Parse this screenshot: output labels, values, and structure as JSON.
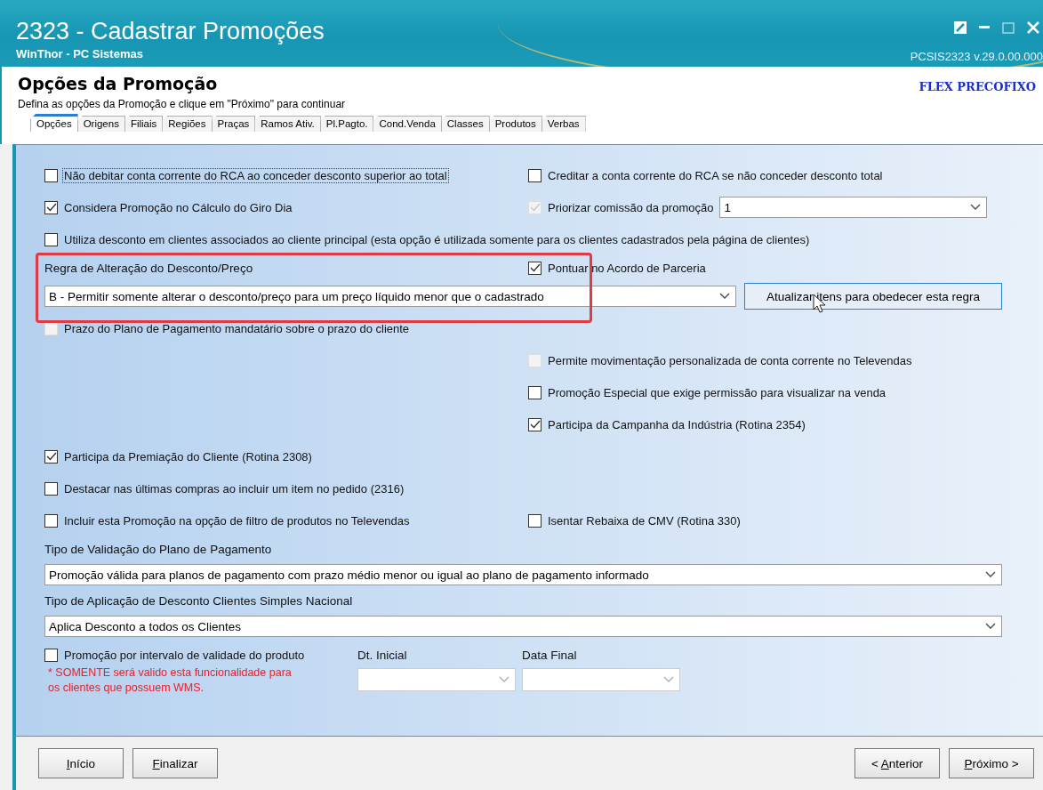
{
  "window": {
    "title": "2323 - Cadastrar Promoções",
    "subtitle": "WinThor - PC Sistemas",
    "version": "PCSIS2323  v.29.0.00.000"
  },
  "header": {
    "title": "Opções da Promoção",
    "hint": "Defina as opções da Promoção e clique em \"Próximo\" para continuar",
    "badge": "FLEX PRECOFIXO"
  },
  "tabs": [
    {
      "label": "Opções",
      "selected": true
    },
    {
      "label": "Origens",
      "selected": false
    },
    {
      "label": "Filiais",
      "selected": false
    },
    {
      "label": "Regiões",
      "selected": false
    },
    {
      "label": "Praças",
      "selected": false
    },
    {
      "label": "Ramos Ativ.",
      "selected": false
    },
    {
      "label": "Pl.Pagto.",
      "selected": false
    },
    {
      "label": "Cond.Venda",
      "selected": false
    },
    {
      "label": "Classes",
      "selected": false
    },
    {
      "label": "Produtos",
      "selected": false
    },
    {
      "label": "Verbas",
      "selected": false
    }
  ],
  "rows": [
    {
      "left": {
        "kind": "checkbox",
        "label": "Não debitar conta corrente do RCA ao conceder desconto superior ao total",
        "checked": false,
        "disabled": false,
        "focused": true
      },
      "right": {
        "kind": "checkbox",
        "label": "Creditar a conta corrente do RCA se não conceder desconto total",
        "checked": false,
        "disabled": false,
        "focused": false
      }
    },
    {
      "left": {
        "kind": "checkbox",
        "label": "Considera Promoção no Cálculo do Giro Dia",
        "checked": true,
        "disabled": false,
        "focused": false
      },
      "right": {
        "kind": "checkbox_combo",
        "label": "Priorizar comissão da promoção",
        "checked": true,
        "disabled": true,
        "focused": false,
        "value": "1"
      }
    },
    {
      "full": {
        "kind": "checkbox",
        "label": "Utiliza desconto em clientes associados ao cliente principal (esta opção é utilizada somente para os clientes cadastrados pela  página de clientes)",
        "checked": false,
        "disabled": false,
        "focused": false
      }
    },
    {
      "left": {
        "kind": "label",
        "text": "Regra de Alteração do Desconto/Preço"
      },
      "right": {
        "kind": "checkbox",
        "label": "Pontuar no Acordo de Parceria",
        "checked": true,
        "disabled": false,
        "focused": false
      }
    },
    {
      "full": {
        "kind": "combo_button",
        "value": "B - Permitir somente alterar o desconto/preço para um preço líquido menor que o cadastrado",
        "button": "Atualizar itens para obedecer esta regra"
      }
    },
    {
      "left": {
        "kind": "checkbox",
        "label": "Prazo do Plano de Pagamento mandatário sobre o prazo do cliente",
        "checked": false,
        "disabled": true,
        "focused": false
      }
    },
    {
      "right": {
        "kind": "checkbox",
        "label": "Permite movimentação personalizada de conta corrente no Televendas",
        "checked": false,
        "disabled": true,
        "focused": false
      }
    },
    {
      "right": {
        "kind": "checkbox",
        "label": "Promoção Especial que exige permissão para visualizar na venda",
        "checked": false,
        "disabled": false,
        "focused": false
      }
    },
    {
      "right": {
        "kind": "checkbox",
        "label": "Participa da Campanha da Indústria (Rotina 2354)",
        "checked": true,
        "disabled": false,
        "focused": false
      }
    },
    {
      "left": {
        "kind": "checkbox",
        "label": "Participa da Premiação do Cliente (Rotina 2308)",
        "checked": true,
        "disabled": false,
        "focused": false
      }
    },
    {
      "left": {
        "kind": "checkbox",
        "label": "Destacar nas últimas compras ao incluir um item no pedido (2316)",
        "checked": false,
        "disabled": false,
        "focused": false
      }
    },
    {
      "left": {
        "kind": "checkbox",
        "label": "Incluir esta Promoção na opção de filtro de produtos no Televendas",
        "checked": false,
        "disabled": false,
        "focused": false
      },
      "right": {
        "kind": "checkbox",
        "label": "Isentar Rebaixa de CMV (Rotina 330)",
        "checked": false,
        "disabled": false,
        "focused": false
      }
    },
    {
      "full": {
        "kind": "label",
        "text": "Tipo de Validação do Plano de Pagamento"
      }
    },
    {
      "full": {
        "kind": "combo",
        "value": "Promoção válida para planos de pagamento com prazo médio menor ou igual ao plano de pagamento informado"
      }
    },
    {
      "full": {
        "kind": "label",
        "text": "Tipo de Aplicação de Desconto Clientes Simples Nacional"
      }
    },
    {
      "full": {
        "kind": "combo",
        "value": "Aplica Desconto a todos os Clientes"
      }
    }
  ],
  "validity": {
    "label": "Promoção por intervalo de validade do produto",
    "checked": false,
    "note": "* SOMENTE será valido esta funcionalidade para os clientes que possuem WMS.",
    "dates": [
      {
        "label": "Dt. Inicial"
      },
      {
        "label": "Data Final"
      }
    ]
  },
  "buttons_left": [
    {
      "hotkey": "I",
      "rest": "nício"
    },
    {
      "hotkey": "F",
      "rest": "inalizar"
    }
  ],
  "buttons_right": [
    {
      "prefix": "< ",
      "hotkey": "A",
      "rest": "nterior"
    },
    {
      "hotkey": "P",
      "rest": "róximo >"
    }
  ]
}
